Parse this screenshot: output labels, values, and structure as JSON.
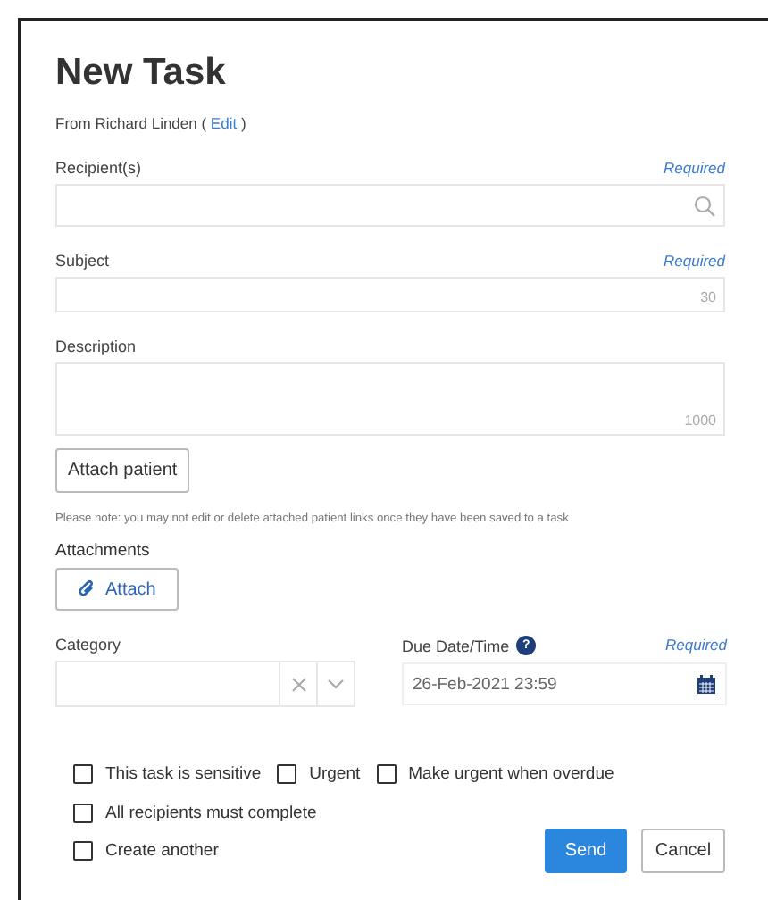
{
  "title": "New Task",
  "from": {
    "text": "From Richard Linden (",
    "link": "Edit",
    "close": ")"
  },
  "fields": [
    {
      "kind": "search",
      "label": "Recipient(s)",
      "required": "Required"
    },
    {
      "kind": "text",
      "label": "Subject",
      "required": "Required",
      "counter": "30"
    },
    {
      "kind": "textarea",
      "label": "Description",
      "counter": "1000"
    }
  ],
  "attach_patient": "Attach patient",
  "note": "Please note: you may not edit or delete attached patient links once they have been saved to a task",
  "attachments": {
    "label": "Attachments",
    "button": "Attach"
  },
  "category": {
    "label": "Category"
  },
  "due": {
    "label": "Due Date/Time",
    "help": "?",
    "required": "Required",
    "value": "26-Feb-2021 23:59"
  },
  "check_rows": [
    [
      {
        "label": "This task is sensitive",
        "checked": false
      },
      {
        "label": "Urgent",
        "checked": false
      },
      {
        "label": "Make urgent when overdue",
        "checked": false
      }
    ],
    [
      {
        "label": "All recipients must complete",
        "checked": false
      }
    ],
    [
      {
        "label": "Create another",
        "checked": false
      }
    ]
  ],
  "buttons": [
    {
      "label": "Send",
      "kind": "primary"
    },
    {
      "label": "Cancel",
      "kind": "secondary"
    }
  ]
}
